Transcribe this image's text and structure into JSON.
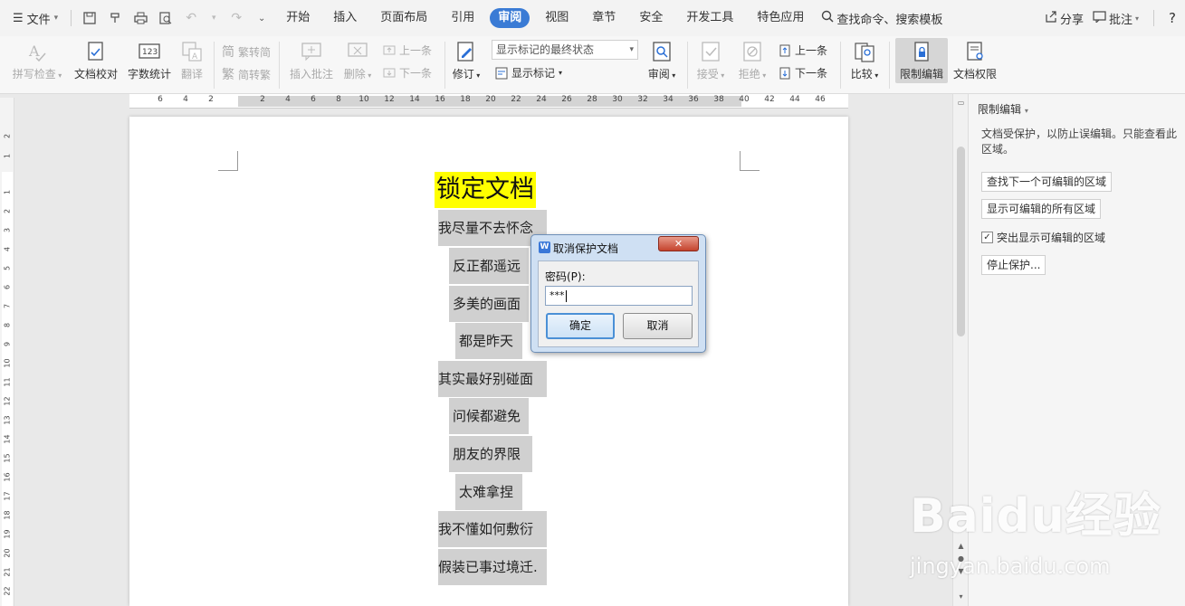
{
  "menubar": {
    "file_label": "文件",
    "tabs": [
      "开始",
      "插入",
      "页面布局",
      "引用",
      "审阅",
      "视图",
      "章节",
      "安全",
      "开发工具",
      "特色应用"
    ],
    "active_tab": "审阅",
    "search_label": "查找命令、搜索模板",
    "share_label": "分享",
    "comment_label": "批注",
    "help_label": "?"
  },
  "ribbon": {
    "spell_check": "拼写检查",
    "doc_proof": "文档校对",
    "word_count": "字数统计",
    "translate": "翻译",
    "trad_to_simp": "繁转简",
    "simp_to_trad": "简转繁",
    "insert_comment": "插入批注",
    "delete": "删除",
    "prev_comment": "上一条",
    "next_comment": "下一条",
    "track_changes": "修订",
    "display_mode": "显示标记的最终状态",
    "show_markup": "显示标记",
    "review": "审阅",
    "accept": "接受",
    "reject": "拒绝",
    "prev_change": "上一条",
    "next_change": "下一条",
    "compare": "比较",
    "restrict_editing": "限制编辑",
    "doc_permissions": "文档权限"
  },
  "ruler": {
    "h_ticks": [
      "6",
      "4",
      "2",
      "2",
      "4",
      "6",
      "8",
      "10",
      "12",
      "14",
      "16",
      "18",
      "20",
      "22",
      "24",
      "26",
      "28",
      "30",
      "32",
      "34",
      "36",
      "38",
      "40",
      "42",
      "44",
      "46"
    ],
    "v_ticks": [
      "2",
      "1",
      "1",
      "2",
      "3",
      "4",
      "5",
      "6",
      "7",
      "8",
      "9",
      "10",
      "11",
      "12",
      "13",
      "14",
      "15",
      "16",
      "17",
      "18",
      "19",
      "20",
      "21",
      "22"
    ]
  },
  "document": {
    "title": "锁定文档",
    "lines": [
      "我尽量不去怀念",
      "反正都遥远",
      "多美的画面",
      "都是昨天",
      "其实最好别碰面",
      "问候都避免",
      "朋友的界限",
      "太难拿捏",
      "我不懂如何敷衍",
      "假装已事过境迁."
    ]
  },
  "dialog": {
    "title": "取消保护文档",
    "password_label": "密码(P):",
    "password_value": "***",
    "ok_label": "确定",
    "cancel_label": "取消"
  },
  "pane": {
    "title": "限制编辑",
    "description": "文档受保护，以防止误编辑。只能查看此区域。",
    "find_next_button": "查找下一个可编辑的区域",
    "show_all_button": "显示可编辑的所有区域",
    "highlight_checkbox": "突出显示可编辑的区域",
    "highlight_checked": true,
    "stop_protect_button": "停止保护..."
  },
  "watermark": {
    "brand": "Baidu经验",
    "url": "jingyan.baidu.com"
  }
}
